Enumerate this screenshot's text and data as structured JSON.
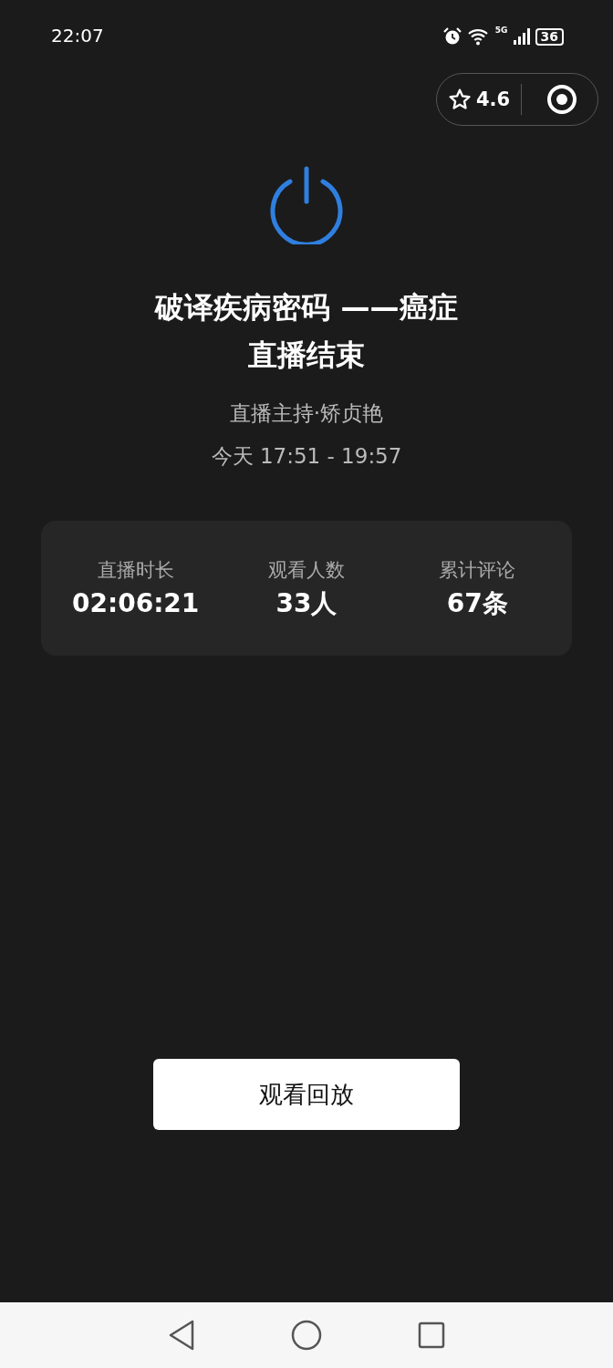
{
  "status_bar": {
    "time": "22:07",
    "network": "5G",
    "battery": "36"
  },
  "capsule": {
    "rating": "4.6"
  },
  "live": {
    "title_lines": [
      "破译疾病密码 ——癌症",
      "直播结束"
    ],
    "host": "直播主持·矫贞艳",
    "time_range": "今天 17:51 - 19:57"
  },
  "stats": [
    {
      "label": "直播时长",
      "value": "02:06:21"
    },
    {
      "label": "观看人数",
      "value": "33人"
    },
    {
      "label": "累计评论",
      "value": "67条"
    }
  ],
  "replay_button": "观看回放"
}
